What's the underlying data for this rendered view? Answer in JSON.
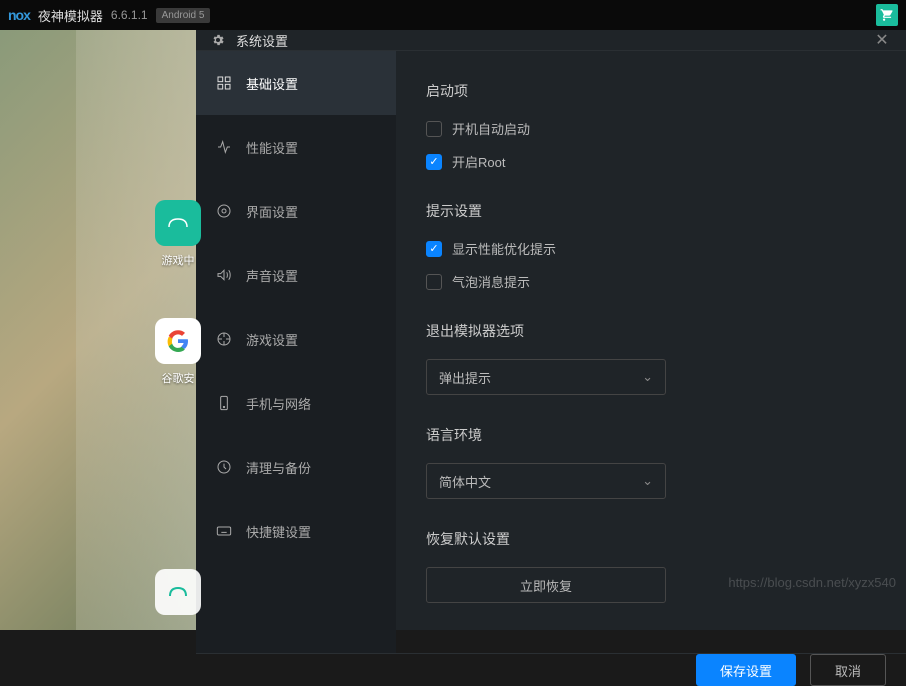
{
  "titlebar": {
    "logo": "nox",
    "title": "夜神模拟器",
    "version": "6.6.1.1",
    "android_badge": "Android 5"
  },
  "desktop": {
    "apps": [
      {
        "label": "游戏中",
        "icon": "nox-game"
      },
      {
        "label": "谷歌安",
        "icon": "google"
      }
    ]
  },
  "panel": {
    "title": "系统设置"
  },
  "sidebar": {
    "items": [
      {
        "label": "基础设置",
        "icon": "basic"
      },
      {
        "label": "性能设置",
        "icon": "performance"
      },
      {
        "label": "界面设置",
        "icon": "interface"
      },
      {
        "label": "声音设置",
        "icon": "sound"
      },
      {
        "label": "游戏设置",
        "icon": "game"
      },
      {
        "label": "手机与网络",
        "icon": "mobile"
      },
      {
        "label": "清理与备份",
        "icon": "cleanup"
      },
      {
        "label": "快捷键设置",
        "icon": "keyboard"
      }
    ],
    "active_index": 0
  },
  "content": {
    "startup": {
      "title": "启动项",
      "auto_start": {
        "label": "开机自动启动",
        "checked": false
      },
      "enable_root": {
        "label": "开启Root",
        "checked": true
      }
    },
    "hints": {
      "title": "提示设置",
      "perf_hint": {
        "label": "显示性能优化提示",
        "checked": true
      },
      "bubble_hint": {
        "label": "气泡消息提示",
        "checked": false
      }
    },
    "exit": {
      "title": "退出模拟器选项",
      "selected": "弹出提示"
    },
    "language": {
      "title": "语言环境",
      "selected": "简体中文"
    },
    "restore": {
      "title": "恢复默认设置",
      "button": "立即恢复"
    }
  },
  "footer": {
    "save": "保存设置",
    "cancel": "取消"
  },
  "watermark": "https://blog.csdn.net/xyzx540"
}
